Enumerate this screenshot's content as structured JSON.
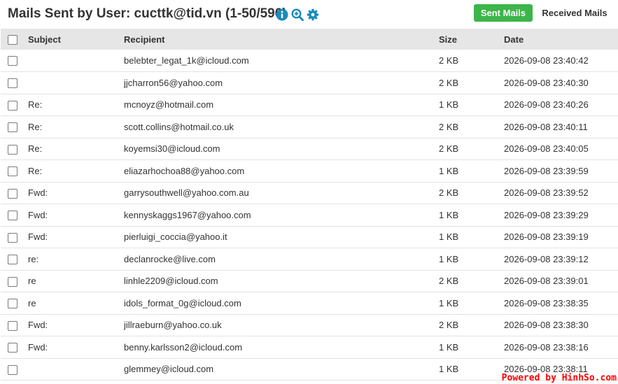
{
  "header": {
    "title": "Mails Sent by User: cucttk@tid.vn (1-50/596)",
    "sent_label": "Sent Mails",
    "received_label": "Received Mails",
    "icons": [
      "info-icon",
      "zoom-in-icon",
      "gear-icon"
    ],
    "accent_color": "#3cb54a",
    "icon_color": "#1a8bbd"
  },
  "table": {
    "columns": {
      "subject": "Subject",
      "recipient": "Recipient",
      "size": "Size",
      "date": "Date"
    },
    "rows": [
      {
        "subject": "",
        "recipient": "belebter_legat_1k@icloud.com",
        "size": "2 KB",
        "date": "2026-09-08 23:40:42"
      },
      {
        "subject": "",
        "recipient": "jjcharron56@yahoo.com",
        "size": "2 KB",
        "date": "2026-09-08 23:40:30"
      },
      {
        "subject": "Re:",
        "recipient": "mcnoyz@hotmail.com",
        "size": "1 KB",
        "date": "2026-09-08 23:40:26"
      },
      {
        "subject": "Re:",
        "recipient": "scott.collins@hotmail.co.uk",
        "size": "2 KB",
        "date": "2026-09-08 23:40:11"
      },
      {
        "subject": "Re:",
        "recipient": "koyemsi30@icloud.com",
        "size": "2 KB",
        "date": "2026-09-08 23:40:05"
      },
      {
        "subject": "Re:",
        "recipient": "eliazarhochoa88@yahoo.com",
        "size": "1 KB",
        "date": "2026-09-08 23:39:59"
      },
      {
        "subject": "Fwd:",
        "recipient": "garrysouthwell@yahoo.com.au",
        "size": "2 KB",
        "date": "2026-09-08 23:39:52"
      },
      {
        "subject": "Fwd:",
        "recipient": "kennyskaggs1967@yahoo.com",
        "size": "1 KB",
        "date": "2026-09-08 23:39:29"
      },
      {
        "subject": "Fwd:",
        "recipient": "pierluigi_coccia@yahoo.it",
        "size": "1 KB",
        "date": "2026-09-08 23:39:19"
      },
      {
        "subject": "re:",
        "recipient": "declanrocke@live.com",
        "size": "1 KB",
        "date": "2026-09-08 23:39:12"
      },
      {
        "subject": "re",
        "recipient": "linhle2209@icloud.com",
        "size": "2 KB",
        "date": "2026-09-08 23:39:01"
      },
      {
        "subject": "re",
        "recipient": "idols_format_0g@icloud.com",
        "size": "1 KB",
        "date": "2026-09-08 23:38:35"
      },
      {
        "subject": "Fwd:",
        "recipient": "jillraeburn@yahoo.co.uk",
        "size": "2 KB",
        "date": "2026-09-08 23:38:30"
      },
      {
        "subject": "Fwd:",
        "recipient": "benny.karlsson2@icloud.com",
        "size": "1 KB",
        "date": "2026-09-08 23:38:16"
      },
      {
        "subject": "",
        "recipient": "glemmey@icloud.com",
        "size": "1 KB",
        "date": "2026-09-08 23:38:11"
      }
    ]
  },
  "footer": {
    "text": "Powered by HinhSo.com",
    "color": "#ff0000"
  }
}
